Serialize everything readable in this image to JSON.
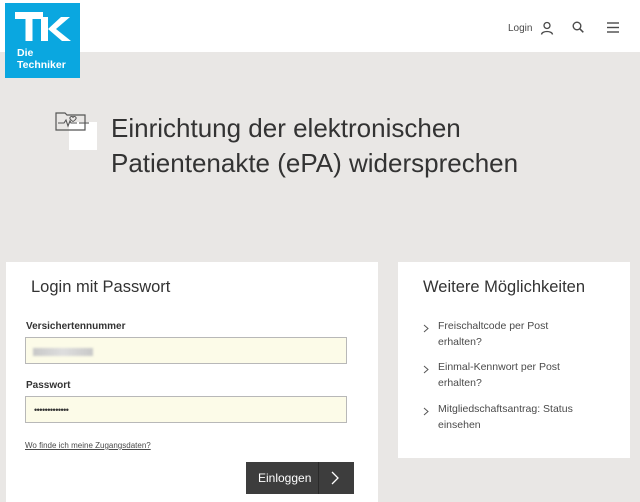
{
  "brand": {
    "logo_line1": "Die",
    "logo_line2": "Techniker",
    "logo_color": "#0aa7e0"
  },
  "header": {
    "login_label": "Login",
    "icons": [
      "user-icon",
      "search-icon",
      "menu-icon"
    ]
  },
  "hero": {
    "title_line1": "Einrichtung der elektronischen",
    "title_line2": "Patientenakte (ePA) widersprechen",
    "icon": "patient-record-icon"
  },
  "login_card": {
    "title": "Login mit Passwort",
    "insurance_label": "Versichertennummer",
    "insurance_value": "",
    "password_label": "Passwort",
    "password_value": "•••••••••••••",
    "help_link": "Wo finde ich meine Zugangsdaten?",
    "submit_label": "Einloggen"
  },
  "more_card": {
    "title": "Weitere Möglichkeiten",
    "items": [
      {
        "line1": "Freischaltcode per Post",
        "line2": "erhalten?"
      },
      {
        "line1": "Einmal-Kennwort per Post",
        "line2": "erhalten?"
      },
      {
        "line1": "Mitgliedschaftsantrag: Status",
        "line2": "einsehen"
      }
    ]
  },
  "colors": {
    "background": "#e9e7e5",
    "input_bg": "#fcfbe8",
    "button": "#3d3d3d"
  }
}
